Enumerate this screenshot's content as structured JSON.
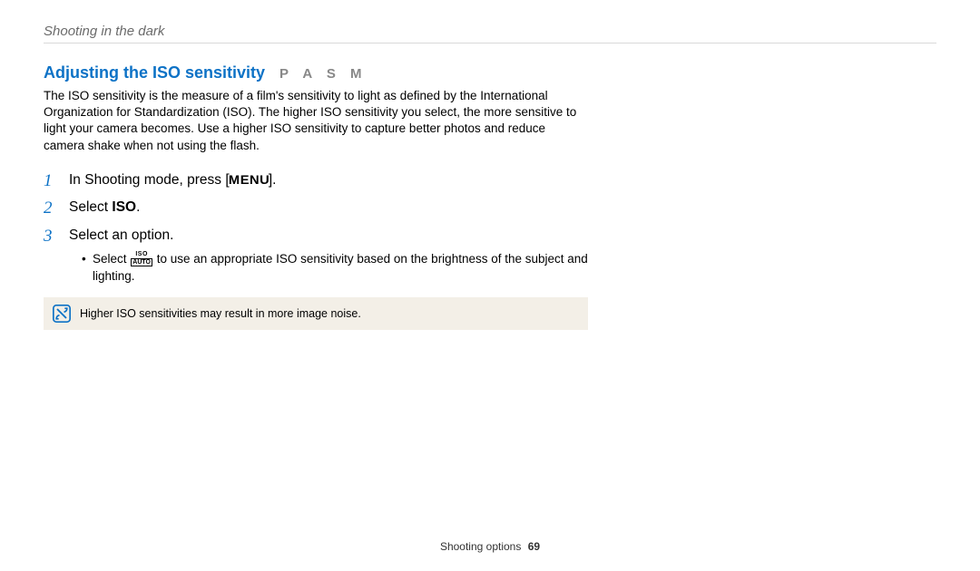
{
  "breadcrumb": "Shooting in the dark",
  "heading": "Adjusting the ISO sensitivity",
  "modes": "P A S M",
  "intro": "The ISO sensitivity is the measure of a film's sensitivity to light as defined by the International Organization for Standardization (ISO). The higher ISO sensitivity you select, the more sensitive to light your camera becomes. Use a higher ISO sensitivity to capture better photos and reduce camera shake when not using the flash.",
  "steps": {
    "s1_pre": "In Shooting mode, press [",
    "s1_menu": "MENU",
    "s1_post": "].",
    "s2_pre": "Select ",
    "s2_bold": "ISO",
    "s2_post": ".",
    "s3": "Select an option.",
    "s3_bullet_pre": "Select ",
    "s3_bullet_post": " to use an appropriate ISO sensitivity based on the brightness of the subject and lighting.",
    "iso_icon_top": "ISO",
    "iso_icon_bot": "AUTO"
  },
  "note": "Higher ISO sensitivities may result in more image noise.",
  "footer_label": "Shooting options",
  "footer_page": "69"
}
